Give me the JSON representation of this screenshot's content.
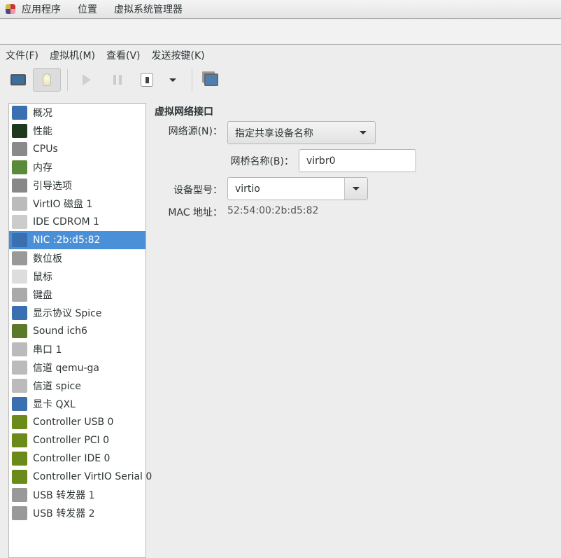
{
  "topbar": {
    "menus": [
      "应用程序",
      "位置",
      "虚拟系统管理器"
    ]
  },
  "menubar": {
    "items": [
      "文件(F)",
      "虚拟机(M)",
      "查看(V)",
      "发送按键(K)"
    ]
  },
  "toolbar": {
    "buttons": [
      "monitor-icon",
      "lightbulb-icon",
      "play-icon",
      "pause-icon",
      "power-icon",
      "dropdown-arrow-icon",
      "screenshot-icon"
    ]
  },
  "sidebar": {
    "selected_index": 7,
    "items": [
      {
        "label": "概况",
        "icon": "monitor-icon",
        "color": "#3a6fb0"
      },
      {
        "label": "性能",
        "icon": "chart-icon",
        "color": "#1e3a1e"
      },
      {
        "label": "CPUs",
        "icon": "cpu-icon",
        "color": "#8a8a8a"
      },
      {
        "label": "内存",
        "icon": "memory-icon",
        "color": "#5a8a3a"
      },
      {
        "label": "引导选项",
        "icon": "gears-icon",
        "color": "#888"
      },
      {
        "label": "VirtIO 磁盘 1",
        "icon": "disk-icon",
        "color": "#bbb"
      },
      {
        "label": "IDE CDROM 1",
        "icon": "cdrom-icon",
        "color": "#ccc"
      },
      {
        "label": "NIC :2b:d5:82",
        "icon": "network-icon",
        "color": "#3a6fb0"
      },
      {
        "label": "数位板",
        "icon": "tablet-icon",
        "color": "#999"
      },
      {
        "label": "鼠标",
        "icon": "mouse-icon",
        "color": "#ddd"
      },
      {
        "label": "键盘",
        "icon": "keyboard-icon",
        "color": "#aaa"
      },
      {
        "label": "显示协议 Spice",
        "icon": "display-icon",
        "color": "#3a6fb0"
      },
      {
        "label": "Sound ich6",
        "icon": "sound-icon",
        "color": "#5a7a2a"
      },
      {
        "label": "串口 1",
        "icon": "serial-icon",
        "color": "#bbb"
      },
      {
        "label": "信道 qemu-ga",
        "icon": "channel-icon",
        "color": "#bbb"
      },
      {
        "label": "信道 spice",
        "icon": "channel-icon",
        "color": "#bbb"
      },
      {
        "label": "显卡 QXL",
        "icon": "video-icon",
        "color": "#3a6fb0"
      },
      {
        "label": "Controller USB 0",
        "icon": "controller-icon",
        "color": "#6a8a1a"
      },
      {
        "label": "Controller PCI 0",
        "icon": "controller-icon",
        "color": "#6a8a1a"
      },
      {
        "label": "Controller IDE 0",
        "icon": "controller-icon",
        "color": "#6a8a1a"
      },
      {
        "label": "Controller VirtIO Serial 0",
        "icon": "controller-icon",
        "color": "#6a8a1a"
      },
      {
        "label": "USB 转发器 1",
        "icon": "usb-icon",
        "color": "#999"
      },
      {
        "label": "USB 转发器 2",
        "icon": "usb-icon",
        "color": "#999"
      }
    ]
  },
  "detail": {
    "title": "虚拟网络接口",
    "source_label": "网络源(N)：",
    "source_value": "指定共享设备名称",
    "bridge_label": "网桥名称(B)：",
    "bridge_value": "virbr0",
    "model_label": "设备型号：",
    "model_value": "virtio",
    "mac_label": "MAC 地址：",
    "mac_value": "52:54:00:2b:d5:82"
  },
  "colors": {
    "selection": "#4a90d9"
  }
}
